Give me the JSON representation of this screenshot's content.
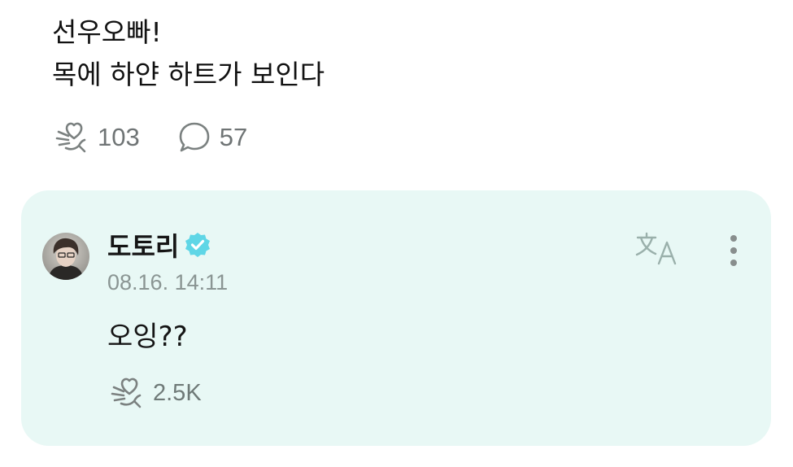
{
  "post": {
    "lines": [
      "선우오빠!",
      "목에 하얀 하트가 보인다"
    ],
    "like_count": "103",
    "comment_count": "57",
    "icons": {
      "like": "heart-cheer-icon",
      "comment": "speech-bubble-icon"
    }
  },
  "comment": {
    "username": "도토리",
    "verified_icon": "verified-badge-icon",
    "timestamp": "08.16. 14:11",
    "text": "오잉??",
    "like_count": "2.5K",
    "icons": {
      "translate": "translate-icon",
      "more": "more-vertical-icon",
      "like": "heart-cheer-icon"
    }
  },
  "colors": {
    "card_background": "#e8f8f5",
    "verified_badge": "#5fd6e6",
    "icon_gray": "#7b8180",
    "translate_icon": "#9ab0ab"
  }
}
